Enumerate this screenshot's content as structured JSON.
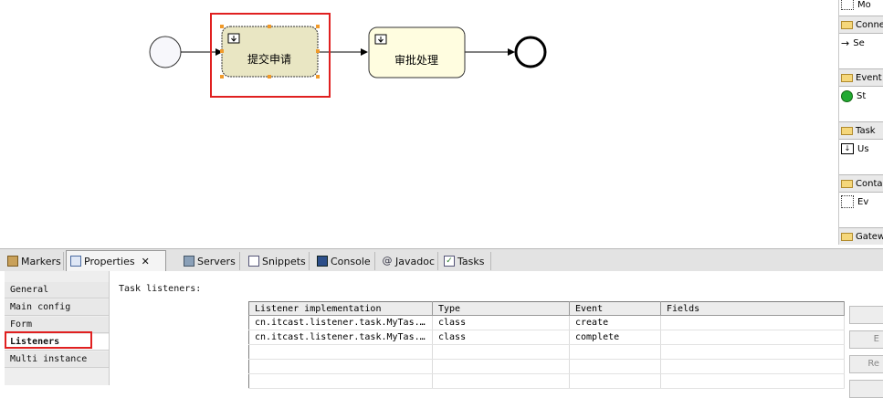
{
  "diagram": {
    "tasks": [
      {
        "label": "提交申请",
        "selected": true
      },
      {
        "label": "审批处理",
        "selected": false
      }
    ]
  },
  "palette": {
    "sections": [
      {
        "header": "",
        "item": "Mo"
      },
      {
        "header": "Conne",
        "item": "Se"
      },
      {
        "header": "Event",
        "item": "St"
      },
      {
        "header": "Task",
        "item": "Us"
      },
      {
        "header": "Conta",
        "item": "Ev"
      },
      {
        "header": "Gatew",
        "item": ""
      }
    ]
  },
  "tabs": [
    {
      "label": "Markers",
      "icon": "markers-icon"
    },
    {
      "label": "Properties",
      "icon": "properties-icon",
      "active": true
    },
    {
      "label": "Servers",
      "icon": "servers-icon"
    },
    {
      "label": "Snippets",
      "icon": "snippets-icon"
    },
    {
      "label": "Console",
      "icon": "console-icon"
    },
    {
      "label": "Javadoc",
      "icon": "at-icon"
    },
    {
      "label": "Tasks",
      "icon": "tasks-icon"
    }
  ],
  "properties": {
    "side_tabs": [
      "General",
      "Main config",
      "Form",
      "Listeners",
      "Multi instance"
    ],
    "active_side_tab": "Listeners",
    "section_title": "Task listeners:",
    "table": {
      "columns": [
        "Listener implementation",
        "Type",
        "Event",
        "Fields"
      ],
      "rows": [
        [
          "cn.itcast.listener.task.MyTas...",
          "class",
          "create",
          ""
        ],
        [
          "cn.itcast.listener.task.MyTas...",
          "class",
          "complete",
          ""
        ]
      ]
    },
    "buttons": [
      "",
      "E",
      "Re"
    ]
  },
  "colors": {
    "selection_red": "#e02020",
    "handle_orange": "#f09a2a",
    "task_fill": "#fffde0",
    "task_selected_fill": "#e9e6c3",
    "start_event_green": "#22aa33"
  }
}
